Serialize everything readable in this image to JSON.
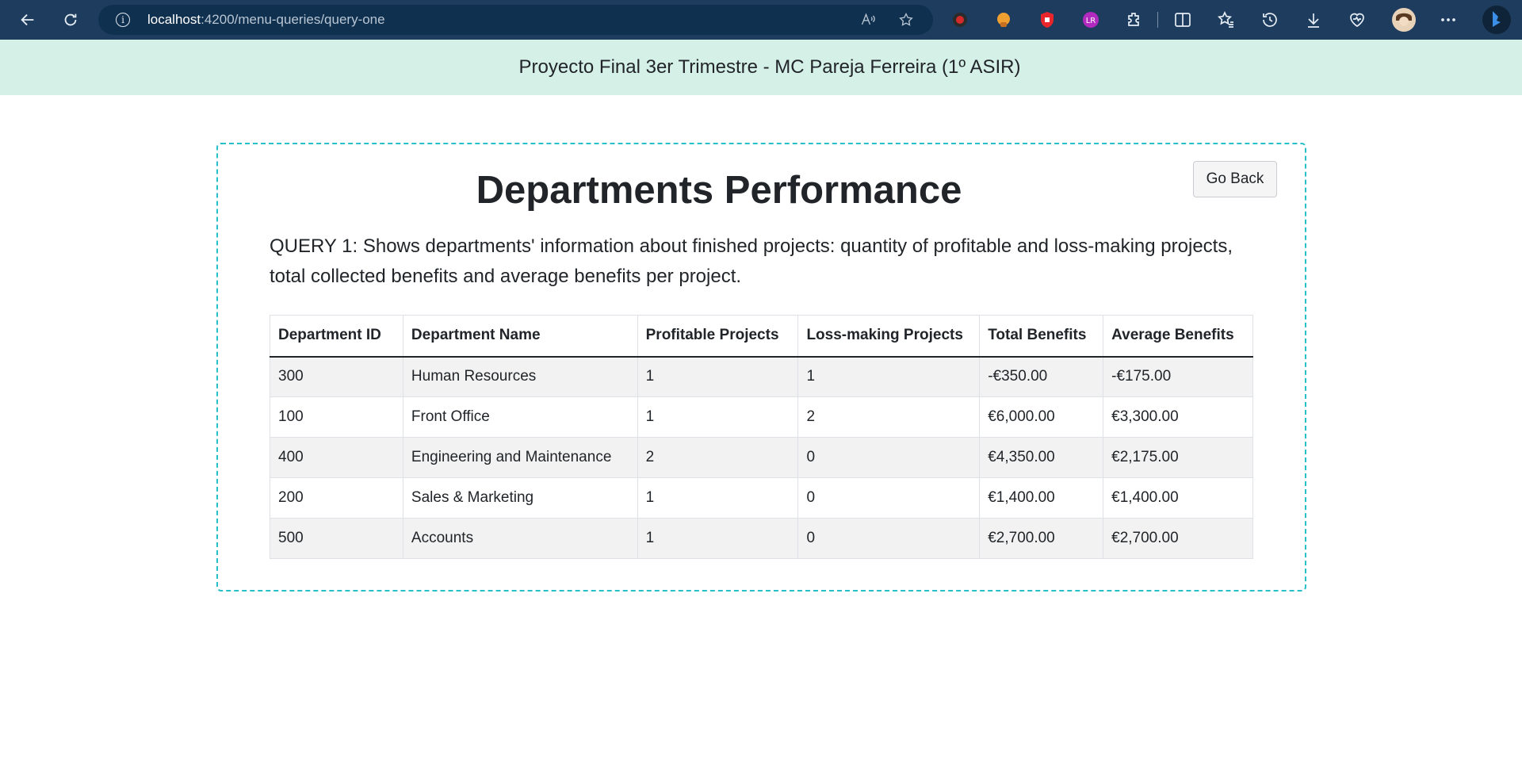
{
  "browser": {
    "url_host": "localhost",
    "url_rest": ":4200/menu-queries/query-one",
    "icons": [
      "back-icon",
      "refresh-icon",
      "info-icon",
      "read-aloud-icon",
      "favorite-star-icon",
      "extension-icon",
      "split-screen-icon",
      "favorites-icon",
      "history-icon",
      "download-icon",
      "browser-essentials-icon",
      "profile-avatar",
      "more-icon",
      "copilot-icon"
    ]
  },
  "header": {
    "title": "Proyecto Final 3er Trimestre - MC Pareja Ferreira (1º ASIR)"
  },
  "card": {
    "go_back_label": "Go Back",
    "title": "Departments Performance",
    "description": "QUERY 1: Shows departments' information about finished projects: quantity of profitable and loss-making projects, total collected benefits and average benefits per project."
  },
  "table": {
    "columns": [
      "Department ID",
      "Department Name",
      "Profitable Projects",
      "Loss-making Projects",
      "Total Benefits",
      "Average Benefits"
    ],
    "rows": [
      [
        "300",
        "Human Resources",
        "1",
        "1",
        "-€350.00",
        "-€175.00"
      ],
      [
        "100",
        "Front Office",
        "1",
        "2",
        "€6,000.00",
        "€3,300.00"
      ],
      [
        "400",
        "Engineering and Maintenance",
        "2",
        "0",
        "€4,350.00",
        "€2,175.00"
      ],
      [
        "200",
        "Sales & Marketing",
        "1",
        "0",
        "€1,400.00",
        "€1,400.00"
      ],
      [
        "500",
        "Accounts",
        "1",
        "0",
        "€2,700.00",
        "€2,700.00"
      ]
    ]
  },
  "colors": {
    "browser_bar": "#1e3d5e",
    "header_bg": "#d5f0e7",
    "card_border": "#27c0c9"
  }
}
